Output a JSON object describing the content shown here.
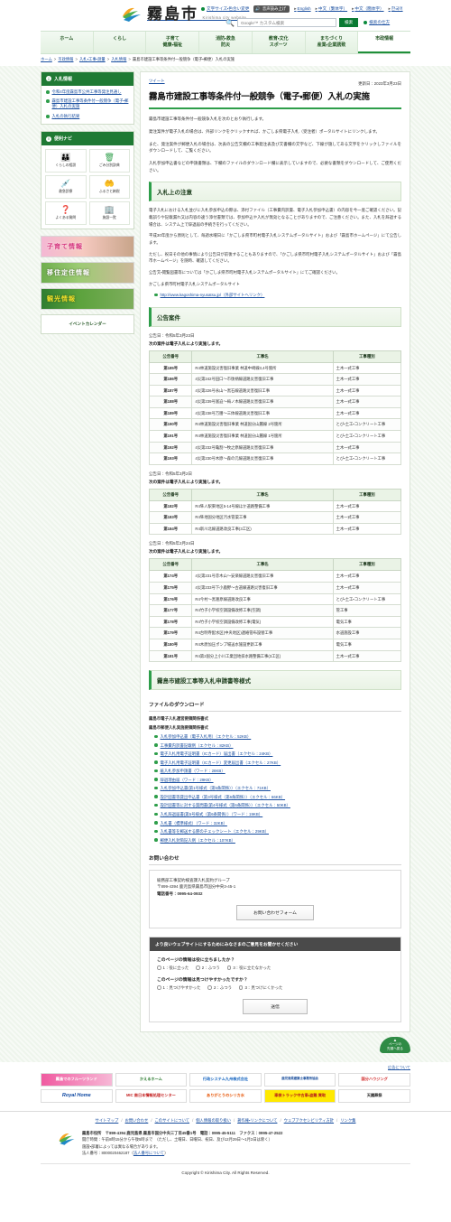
{
  "header": {
    "site_name": "霧島市",
    "site_sub": "Kirishima city website",
    "font_size_link": "文字サイズ・色合い変更",
    "voice_button": "音声読み上げ",
    "languages": [
      "English",
      "中文（繁体字）",
      "中文（簡体字）",
      "한국어"
    ],
    "search_placeholder": "Google™ カスタム検索",
    "search_button": "検索",
    "search_how": "検索の仕方"
  },
  "gnav": [
    {
      "line1": "ホーム",
      "line2": "",
      "active": false
    },
    {
      "line1": "くらし",
      "line2": "",
      "active": false
    },
    {
      "line1": "子育て",
      "line2": "健康・福祉",
      "active": false
    },
    {
      "line1": "消防・救急",
      "line2": "防災",
      "active": false
    },
    {
      "line1": "教育・文化",
      "line2": "スポーツ",
      "active": false
    },
    {
      "line1": "まちづくり",
      "line2": "産業・企業誘致",
      "active": false
    },
    {
      "line1": "市政情報",
      "line2": "",
      "active": true
    }
  ],
  "breadcrumb": {
    "items": [
      "ホーム",
      "市政情報",
      "入札・工事・測量",
      "入札情報"
    ],
    "current": "霧島市建設工事等条件付一般競争（電子・郵便）入札の実施"
  },
  "sidebar": {
    "bid_info": {
      "title": "入札情報",
      "links": [
        "令和4年度霧島市公共工事等発注見通し",
        "霧島市建設工事等条件付一般競争（電子・郵便）入札の実施",
        "入札の執行結果"
      ]
    },
    "navi": {
      "title": "便利ナビ",
      "tiles": [
        {
          "icon": "people-icon",
          "glyph": "\u0000",
          "label": "くらしの相談"
        },
        {
          "icon": "trash-icon",
          "glyph": "\u0000",
          "label": "ごみ分別辞典"
        },
        {
          "icon": "ambulance-icon",
          "glyph": "\u0000",
          "label": "救急診療"
        },
        {
          "icon": "hands-heart-icon",
          "glyph": "\u0000",
          "label": "ふるさと納税"
        },
        {
          "icon": "question-icon",
          "glyph": "\u0000",
          "label": "よくある質問"
        },
        {
          "icon": "building-icon",
          "glyph": "\u0000",
          "label": "施設一覧"
        }
      ]
    },
    "banners": [
      {
        "label": "子育て情報",
        "style": "b-kosodate"
      },
      {
        "label": "移住定住情報",
        "style": "b-ijyuu"
      },
      {
        "label": "観光情報",
        "style": "b-kanko"
      }
    ],
    "event_calendar": "イベントカレンダー"
  },
  "main": {
    "tweet": "ツイート",
    "updated": "更新日：2023年3月23日",
    "title": "霧島市建設工事等条件付一般競争（電子・郵便）入札の実施",
    "intro": [
      "霧島市建設工事等条件付一般競争入札を次のとおり執行します。",
      "発注案件が電子入札の場合は、外部リンクをクリックすれば、かごしま県電子入札（受注者）ポータルサイトにリンクします。",
      "また、発注案件が郵便入札の場合は、次表の公告文欄の工事発注表及び文書欄の文字など、下線が施してある文字をクリックしファイルをダウンロードして、ご覧ください。",
      "入札参加申込書などの申請書類は、下欄のファイルのダウンロード欄に表示していますので、必要な書類をダウンロードして、ご使用ください。"
    ],
    "caution": {
      "heading": "入札上の注意",
      "paragraphs": [
        "電子入札における入札並びに入札参加申込の際は、添付ファイル（工事費内訳書、電子入札参加申込書）の内容を今一度ご確認ください。記載誤りや記載漏れ又は内容の違う添付書類では、参加申込や入札が無効となることがありますので、ご注意ください。また、入札を辞退する場合は、システム上で辞退届の手続きを行ってください。",
        "平成30年度から原則として、毎週水曜日に「かごしま県市町村電子入札システムポータルサイト」および「霧島市ホームページ」にて公告します。",
        "ただし、祝日その他の事情により公告日が前後することもありますので、「かごしま県市町村電子入札システムポータルサイト」および「霧島市ホームページ」を随時、確認してください。",
        "公告文・閲覧図書等については「かごしま県市町村電子入札システムポータルサイト」にてご確認ください。",
        "かごしま県市町村電子入札システムポータルサイト"
      ],
      "portal_link": "http://www.kagoshima-nyusatsu.jp/（外部サイトへリンク）"
    },
    "announcements": {
      "heading": "公告案件",
      "groups": [
        {
          "date_label": "公告日：令和5年3月23日",
          "lead": "次の案件は電子入札により実施します。",
          "columns": [
            "公告番号",
            "工事名",
            "工事種別"
          ],
          "rows": [
            [
              "第185号",
              "R4林道施設災害復旧事業 林道中崎線3,4号箇所",
              "土木一式工事"
            ],
            [
              "第186号",
              "4災第242号田口～市後柄線道路災害復旧工事",
              "土木一式工事"
            ],
            [
              "第187号",
              "4災第226号永山～黒石線道路災害復旧工事",
              "土木一式工事"
            ],
            [
              "第188号",
              "4災第239号富迫～梅ノ木線道路災害復旧工事",
              "土木一式工事"
            ],
            [
              "第189号",
              "4災第238号万膳～三体線道路災害復旧工事",
              "土木一式工事"
            ],
            [
              "第190号",
              "R4林道施設災害復旧事業 林道国分山麓線 2号箇所",
              "とび・土工・コンクリート工事"
            ],
            [
              "第191号",
              "R4林道施設災害復旧事業 林道国分山麓線 1号箇所",
              "とび・土工・コンクリート工事"
            ],
            [
              "第192号",
              "4災第232号亀割～牧之原線道路災害復旧工事",
              "土木一式工事"
            ],
            [
              "第193号",
              "4災第230号木原～森の元線道路災害復旧工事",
              "とび・土工・コンクリート工事"
            ]
          ]
        },
        {
          "date_label": "公告日：令和5年3月2日",
          "lead": "次の案件は電子入札により実施します。",
          "columns": [
            "公告番号",
            "工事名",
            "工事種別"
          ],
          "rows": [
            [
              "第182号",
              "R4隼人駅東地区5-14号線ほか道路整備工事",
              "土木一式工事"
            ],
            [
              "第183号",
              "R4隼地国分地区汚水管渠工事",
              "土木一式工事"
            ],
            [
              "第184号",
              "R4新川北線道路改良工事(3工区)",
              "土木一式工事"
            ]
          ]
        },
        {
          "date_label": "公告日：令和5年2月24日",
          "lead": "次の案件は電子入札により実施します。",
          "columns": [
            "公告番号",
            "工事名",
            "工事種別"
          ],
          "rows": [
            [
              "第174号",
              "4災第231号赤木山～安楽線道路災害復旧工事",
              "土木一式工事"
            ],
            [
              "第175号",
              "4災第233号下小鹿野～古道線道路災害復旧工事",
              "土木一式工事"
            ],
            [
              "第176号",
              "R4今村～黒葛原線道路改良工事",
              "とび・土工・コンクリート工事"
            ],
            [
              "第177号",
              "R4竹子小学校空調設備改修工事(空調)",
              "管工事"
            ],
            [
              "第178号",
              "R4竹子小学校空調設備改修工事(電気)",
              "電気工事"
            ],
            [
              "第179号",
              "R4台明寺配水区(中央地区)連絡管布設替工事",
              "水道施設工事"
            ],
            [
              "第180号",
              "R4木原加圧ポンプ場送水施設更新工事",
              "電気工事"
            ],
            [
              "第181号",
              "R4第2国分上小川工業団地排水路整備工事(3工区)",
              "土木一式工事"
            ]
          ]
        }
      ]
    },
    "forms": {
      "heading": "霧島市建設工事等入札申請書等様式",
      "download_heading": "ファイルのダウンロード",
      "notes": [
        "霧島市電子入札運営要領関係書式",
        "霧島市郵便入札実施要領関係書式"
      ],
      "files": [
        "入札参加申込書（電子入札用）（エクセル：52KB）",
        "工事費内訳書記載例（エクセル：82KB）",
        "電子入札用電子証明書（ICカード）届出書（エクセル：24KB）",
        "電子入札用電子証明書（ICカード）変更届出書（エクセル：27KB）",
        "紙入札参加申請書（ワード：28KB）",
        "辞退理由届（ワード：29KB）",
        "入札参加申込書(第1号様式（第5条関係））（エクセル：71KB）",
        "設計図書等貸出申込書（第3号様式（第6条関係））（エクセル：66KB）",
        "設計図書等に対する質問書(第4号様式（第6条関係））（エクセル：50KB）",
        "入札辞退届書(第5号様式（第6条関係））（ワード：19KB）",
        "入札書（標準様式）（ワード：32KB）",
        "入札書等を郵送する際のチェックシート（エクセル：29KB）",
        "郵便入札封筒記入例（エクセル：107KB）"
      ]
    },
    "contact": {
      "heading": "お問い合わせ",
      "department": "総務部工事契約検査課入札契約グループ",
      "address": "〒899-4394 鹿児島県霧島市国分中央3-45-1",
      "phone": "電話番号：0995-64-0932",
      "form_button": "お問い合わせフォーム"
    },
    "survey": {
      "heading": "より良いウェブサイトにするためにみなさまのご意見をお聞かせください",
      "q1": "このページの情報は役に立ちましたか？",
      "q1_options": [
        "1：役に立った",
        "2：ふつう",
        "3：役に立たなかった"
      ],
      "q2": "このページの情報は見つけやすかったですか？",
      "q2_options": [
        "1：見つけやすかった",
        "2：ふつう",
        "3：見つけにくかった"
      ],
      "submit": "送信"
    },
    "page_top": {
      "arrow": "▲",
      "line1": "ページの",
      "line2": "先頭へ戻る"
    }
  },
  "ads": {
    "about": "広告について",
    "row1": [
      "霧島でのフルーツランド",
      "かえるホーム",
      "行政システム九州株式会社",
      "鹿児島県建築士事務所協会",
      "国分ハウジング"
    ],
    "row2": [
      "Royal Home",
      "MIC 南日本情報処理センター",
      "ありがとうのシリカ水",
      "車検トラック中古車・盗難 買取",
      "天國葬祭"
    ]
  },
  "footer": {
    "links": [
      "サイトマップ",
      "お問い合わせ",
      "このサイトについて",
      "個人情報の取り扱い",
      "著作権・リンクについて",
      "ウェブアクセシビリティ方針",
      "リンク集"
    ],
    "office": "霧島市役所　〒899-4394 鹿児島県 霧島市国分中央三丁目45番1号　電話：0995-45-5111　ファクス：0995-47-2522",
    "hours": "開庁時間：午前8時15分から午後5時まで　（ただし、土曜日、日曜日、祝日、及び12月29日～1月3日は除く）",
    "note": "施設・部署によっては異なる場合があります。",
    "corp_no": "法人番号：8000020462187",
    "corp_no_link": "法人番号について",
    "copyright": "Copyright © Kirishima City. All Rights Reserved."
  }
}
